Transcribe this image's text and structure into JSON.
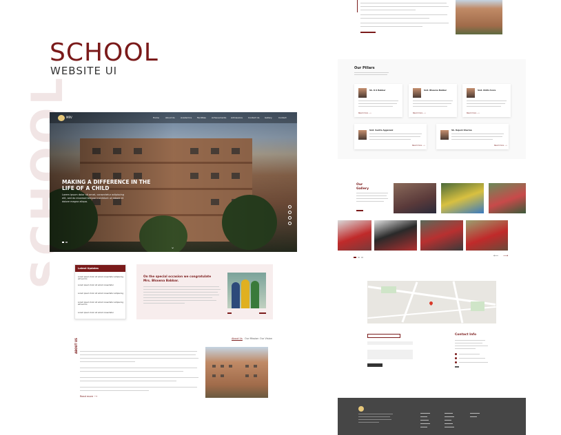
{
  "showcase": {
    "watermark": "SCHOOL",
    "title": "SCHOOL",
    "subtitle": "WEBSITE UI"
  },
  "hero": {
    "logo_text": "MRV",
    "nav": [
      "Home",
      "About Us",
      "Academics",
      "Facilities",
      "Achievements",
      "Admissions",
      "Contact Us",
      "Gallery",
      "Contact"
    ],
    "heading": "MAKING A DIFFERENCE IN THE LIFE OF A CHILD",
    "body": "Lorem ipsum dolor sit amet, consectetur adipiscing elit, sed do eiusmod tempor incididunt ut labore et dolore magna aliqua."
  },
  "updates": {
    "header": "Latest Updates",
    "items": [
      "Lorem ipsum dolor sit amet consectetur adipiscing elit sed do",
      "Lorem ipsum dolor sit amet consectetur",
      "Lorem ipsum dolor sit amet consectetur adipiscing",
      "Lorem ipsum dolor sit amet consectetur adipiscing elit sed do",
      "Lorem ipsum dolor sit amet consectetur"
    ]
  },
  "congrats": {
    "heading": "On the special occasion we congratulate Mrs. Bhawna Babbar."
  },
  "about": {
    "vertical_label": "ABOUT US",
    "tabs": [
      "About Us",
      "Our Mission",
      "Our Vision"
    ],
    "read_more": "Read more ⟶"
  },
  "pillars": {
    "title": "Our Pillars",
    "cards": [
      {
        "name": "Sh. K.S Babbar"
      },
      {
        "name": "Smt. Bhawna Babbar"
      },
      {
        "name": "Smt. Nidhi Arora"
      },
      {
        "name": "Smt. Sunita Aggarwal"
      },
      {
        "name": "Sh. Rajesh Sharma"
      }
    ],
    "read_more": "Read more ⟶"
  },
  "gallery": {
    "title": "Our Gallery"
  },
  "contact": {
    "title": "Contact Info"
  },
  "colors": {
    "accent": "#7a1a1a",
    "footer": "#464646"
  }
}
